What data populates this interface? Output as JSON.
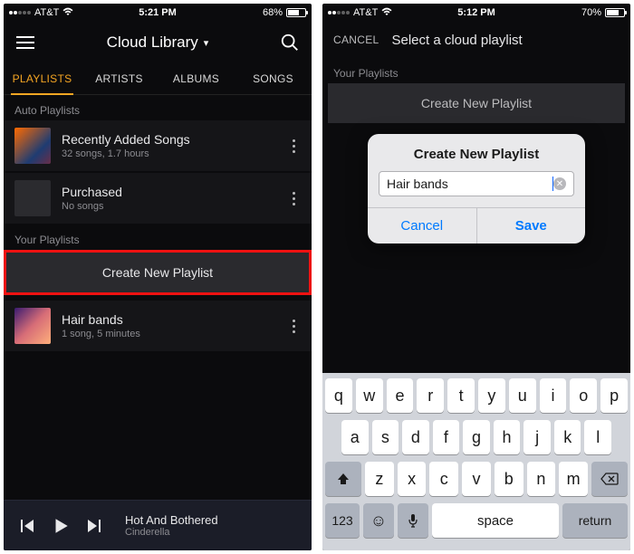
{
  "left": {
    "status": {
      "carrier": "AT&T",
      "time": "5:21 PM",
      "battery_pct": "68%",
      "battery_fill": 68
    },
    "header": {
      "title": "Cloud Library",
      "caret": "▾"
    },
    "tabs": [
      "PLAYLISTS",
      "ARTISTS",
      "ALBUMS",
      "SONGS"
    ],
    "active_tab_index": 0,
    "sections": {
      "auto_label": "Auto Playlists",
      "auto": [
        {
          "title": "Recently Added Songs",
          "sub": "32 songs, 1.7 hours"
        },
        {
          "title": "Purchased",
          "sub": "No songs"
        }
      ],
      "your_label": "Your Playlists",
      "create_label": "Create New Playlist",
      "your": [
        {
          "title": "Hair bands",
          "sub": "1 song, 5 minutes"
        }
      ]
    },
    "now_playing": {
      "title": "Hot And Bothered",
      "artist": "Cinderella"
    }
  },
  "right": {
    "status": {
      "carrier": "AT&T",
      "time": "5:12 PM",
      "battery_pct": "70%",
      "battery_fill": 70
    },
    "header": {
      "cancel": "CANCEL",
      "title": "Select a cloud playlist"
    },
    "section_label": "Your Playlists",
    "create_label": "Create New Playlist",
    "dialog": {
      "title": "Create New Playlist",
      "input_value": "Hair bands",
      "cancel": "Cancel",
      "save": "Save"
    },
    "keyboard": {
      "row1": [
        "q",
        "w",
        "e",
        "r",
        "t",
        "y",
        "u",
        "i",
        "o",
        "p"
      ],
      "row2": [
        "a",
        "s",
        "d",
        "f",
        "g",
        "h",
        "j",
        "k",
        "l"
      ],
      "row3": [
        "z",
        "x",
        "c",
        "v",
        "b",
        "n",
        "m"
      ],
      "num": "123",
      "space": "space",
      "return": "return"
    }
  }
}
